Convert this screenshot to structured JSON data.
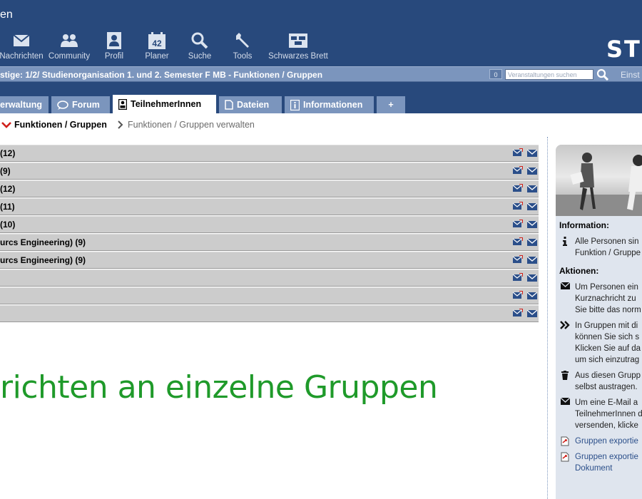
{
  "header": {
    "title": "en",
    "logo": "ST",
    "nav": [
      {
        "id": "nachrichten",
        "label": "Nachrichten",
        "icon": "envelope-icon"
      },
      {
        "id": "community",
        "label": "Community",
        "icon": "people-icon"
      },
      {
        "id": "profil",
        "label": "Profil",
        "icon": "profile-icon"
      },
      {
        "id": "planer",
        "label": "Planer",
        "icon": "calendar-icon",
        "badge": "42"
      },
      {
        "id": "suche",
        "label": "Suche",
        "icon": "magnifier-icon"
      },
      {
        "id": "tools",
        "label": "Tools",
        "icon": "wrench-icon"
      },
      {
        "id": "schwarzes-brett",
        "label": "Schwarzes Brett",
        "icon": "board-icon"
      }
    ]
  },
  "context": {
    "title": "stige: 1/2/ Studienorganisation 1. und 2. Semester F MB - Funktionen / Gruppen",
    "search_count": "0",
    "search_placeholder": "Veranstaltungen suchen",
    "right_label": "Einst"
  },
  "tabs": [
    {
      "id": "verwaltung",
      "label": "erwaltung",
      "icon": ""
    },
    {
      "id": "forum",
      "label": "Forum",
      "icon": "speech-bubble-icon"
    },
    {
      "id": "teilnehmer",
      "label": "TeilnehmerInnen",
      "icon": "person-card-icon",
      "active": true
    },
    {
      "id": "dateien",
      "label": "Dateien",
      "icon": "document-icon"
    },
    {
      "id": "informationen",
      "label": "Informationen",
      "icon": "info-icon"
    },
    {
      "id": "plus",
      "label": "+",
      "icon": ""
    }
  ],
  "subnav": {
    "active": "Funktionen / Gruppen",
    "inactive": "Funktionen / Gruppen verwalten"
  },
  "groups": [
    {
      "name": "(12)"
    },
    {
      "name": "(9)"
    },
    {
      "name": "(12)"
    },
    {
      "name": "(11)"
    },
    {
      "name": "(10)"
    },
    {
      "name": "urcs Engineering) (9)"
    },
    {
      "name": "urcs Engineering) (9)"
    },
    {
      "name": ""
    },
    {
      "name": ""
    },
    {
      "name": ""
    }
  ],
  "big_text": "richten an einzelne Gruppen",
  "sidebar": {
    "information_heading": "Information:",
    "information_items": [
      {
        "icon": "info-icon",
        "lines": [
          "Alle Personen sin",
          "Funktion / Gruppe"
        ]
      }
    ],
    "actions_heading": "Aktionen:",
    "action_items": [
      {
        "icon": "envelope-icon",
        "lines": [
          "Um Personen ein",
          "Kurznachricht zu",
          "Sie bitte das norm"
        ]
      },
      {
        "icon": "double-chevron-icon",
        "lines": [
          "In Gruppen mit di",
          "können Sie sich s",
          "Klicken Sie auf da",
          "um sich einzutrag"
        ]
      },
      {
        "icon": "trash-icon",
        "lines": [
          "Aus diesen Grupp",
          "selbst austragen."
        ]
      },
      {
        "icon": "envelope-icon",
        "lines": [
          "Um eine E-Mail a",
          "TeilnehmerInnen d",
          "versenden, klicke"
        ]
      },
      {
        "icon": "export-icon",
        "link": true,
        "lines": [
          "Gruppen exportie"
        ]
      },
      {
        "icon": "export-icon",
        "link": true,
        "lines": [
          "Gruppen exportie",
          "Dokument"
        ]
      }
    ]
  },
  "colors": {
    "header_bg": "#28497c",
    "bar_bg": "#7b95bd",
    "row_bg": "#cccccc",
    "green_text": "#1f9a2a",
    "sidebar_bg": "#dfe5ee"
  }
}
